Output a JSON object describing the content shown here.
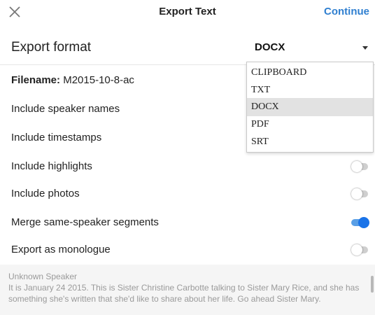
{
  "header": {
    "title": "Export Text",
    "continue_label": "Continue"
  },
  "export_format": {
    "label": "Export format",
    "selected": "DOCX",
    "options": [
      "CLIPBOARD",
      "TXT",
      "DOCX",
      "PDF",
      "SRT"
    ]
  },
  "filename": {
    "label": "Filename:",
    "value": "M2015-10-8-ac"
  },
  "options": [
    {
      "label": "Include speaker names",
      "state": null
    },
    {
      "label": "Include timestamps",
      "state": null
    },
    {
      "label": "Include highlights",
      "state": "off"
    },
    {
      "label": "Include photos",
      "state": "off"
    },
    {
      "label": "Merge same-speaker segments",
      "state": "on"
    },
    {
      "label": "Export as monologue",
      "state": "off"
    }
  ],
  "transcript": {
    "speaker": "Unknown Speaker",
    "text": "It is January 24 2015. This is Sister Christine Carbotte talking to Sister Mary Rice, and she has something she's written that she'd like to share about her life. Go ahead Sister Mary."
  },
  "colors": {
    "accent": "#2f7fd0",
    "toggle_on": "#1a73e8",
    "toggle_off": "#cfcfcf"
  },
  "icons": {
    "close": "close-icon",
    "dropdown": "chevron-down-icon"
  }
}
